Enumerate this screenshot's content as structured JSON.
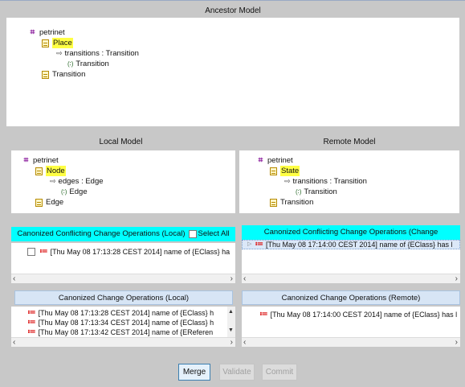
{
  "ancestor": {
    "title": "Ancestor Model",
    "tree": {
      "root": "petrinet",
      "place": "Place",
      "ref": "transitions : Transition",
      "ref_type": "Transition",
      "transition": "Transition"
    }
  },
  "local": {
    "title": "Local Model",
    "tree": {
      "root": "petrinet",
      "node": "Node",
      "ref": "edges : Edge",
      "ref_type": "Edge",
      "edge": "Edge"
    },
    "conflicts": {
      "title": "Canonized Conflicting Change Operations (Local)",
      "select_all": "Select All",
      "items": [
        "[Thu May 08 17:13:28 CEST 2014] name of {EClass} ha"
      ]
    },
    "changes": {
      "title": "Canonized Change Operations (Local)",
      "items": [
        "[Thu May 08 17:13:28 CEST 2014] name of {EClass} h",
        "[Thu May 08 17:13:34 CEST 2014] name of {EClass} h",
        "[Thu May 08 17:13:42 CEST 2014] name of {EReferen"
      ]
    }
  },
  "remote": {
    "title": "Remote Model",
    "tree": {
      "root": "petrinet",
      "state": "State",
      "ref": "transitions : Transition",
      "ref_type": "Transition",
      "transition": "Transition"
    },
    "conflicts": {
      "title": "Canonized Conflicting Change Operations (Change",
      "items": [
        "[Thu May 08 17:14:00 CEST 2014] name of {EClass} has l"
      ]
    },
    "changes": {
      "title": "Canonized Change Operations (Remote)",
      "items": [
        "[Thu May 08 17:14:00 CEST 2014] name of {EClass} has l"
      ]
    }
  },
  "buttons": {
    "merge": "Merge",
    "validate": "Validate",
    "commit": "Commit"
  },
  "icons": {
    "package": "package-icon",
    "class": "eclass-icon",
    "reference": "ereference-icon",
    "type": "etype-icon",
    "operation": "change-operation-icon"
  }
}
